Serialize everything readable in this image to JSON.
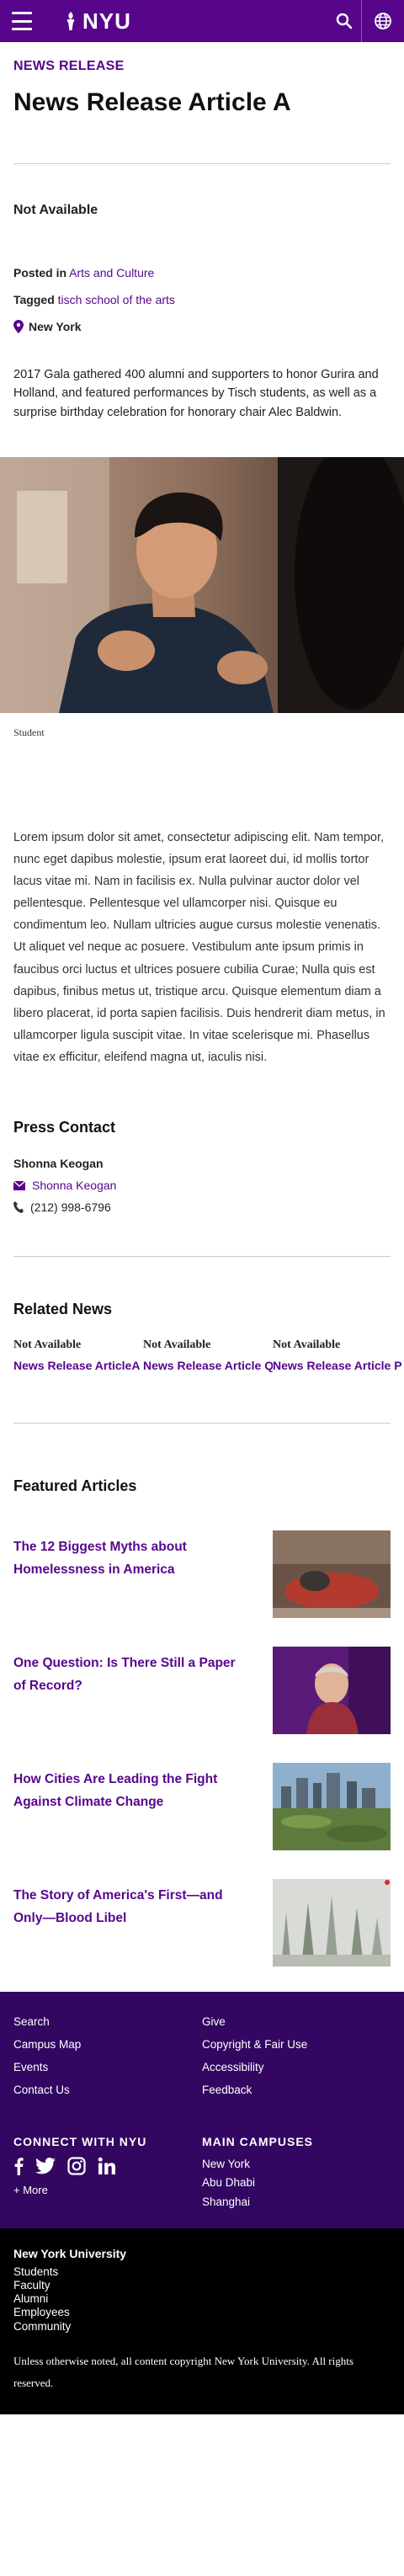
{
  "header": {
    "logo_text": "NYU",
    "menu_icon": "hamburger-menu-icon",
    "search_icon": "search-icon",
    "globe_icon": "globe-icon",
    "brand_color": "#57068c"
  },
  "article": {
    "eyebrow": "NEWS RELEASE",
    "title": "News Release Article A",
    "status_heading": "Not Available",
    "posted_label": "Posted in",
    "posted_category": "Arts and Culture",
    "tagged_label": "Tagged",
    "tag": "tisch school of the arts",
    "location": "New York",
    "summary": "2017 Gala gathered 400 alumni and supporters to honor Gurira and Holland, and featured performances by Tisch students, as well as a surprise birthday celebration for honorary chair Alec Baldwin.",
    "image_caption": "Student",
    "body": "Lorem ipsum dolor sit amet, consectetur adipiscing elit. Nam tempor, nunc eget dapibus molestie, ipsum erat laoreet dui, id mollis tortor lacus vitae mi. Nam in facilisis ex. Nulla pulvinar auctor dolor vel pellentesque. Pellentesque vel ullamcorper nisi. Quisque eu condimentum leo. Nullam ultricies augue cursus molestie venenatis. Ut aliquet vel neque ac posuere. Vestibulum ante ipsum primis in faucibus orci luctus et ultrices posuere cubilia Curae; Nulla quis est dapibus, finibus metus ut, tristique arcu. Quisque elementum diam a libero placerat, id porta sapien facilisis. Duis hendrerit diam metus, in ullamcorper ligula suscipit vitae. In vitae scelerisque mi. Phasellus vitae ex efficitur, eleifend magna ut, iaculis nisi."
  },
  "press_contact": {
    "heading": "Press Contact",
    "name": "Shonna Keogan",
    "email_label": "Shonna Keogan",
    "phone": "(212) 998-6796"
  },
  "related": {
    "heading": "Related News",
    "items": [
      {
        "status": "Not Available",
        "link": "News Release ArticleA"
      },
      {
        "status": "Not Available",
        "link": "News Release Article QN"
      },
      {
        "status": "Not Available",
        "link": "News Release Article P"
      }
    ]
  },
  "featured": {
    "heading": "Featured Articles",
    "items": [
      {
        "title": "The 12 Biggest Myths about Homelessness in America"
      },
      {
        "title": "One Question: Is There Still a Paper of Record?"
      },
      {
        "title": "How Cities Are Leading the Fight Against Climate Change"
      },
      {
        "title": "The Story of America's First—and Only—Blood Libel"
      }
    ]
  },
  "footer": {
    "links_left": [
      "Search",
      "Campus Map",
      "Events",
      "Contact Us"
    ],
    "links_right": [
      "Give",
      "Copyright & Fair Use",
      "Accessibility",
      "Feedback"
    ],
    "connect_heading": "CONNECT WITH NYU",
    "more": "+ More",
    "campuses_heading": "MAIN CAMPUSES",
    "campuses": [
      "New York",
      "Abu Dhabi",
      "Shanghai"
    ],
    "bottom_heading": "New York University",
    "bottom_links": [
      "Students",
      "Faculty",
      "Alumni",
      "Employees",
      "Community"
    ],
    "copyright": "Unless otherwise noted, all content copyright New York University. All rights reserved."
  }
}
